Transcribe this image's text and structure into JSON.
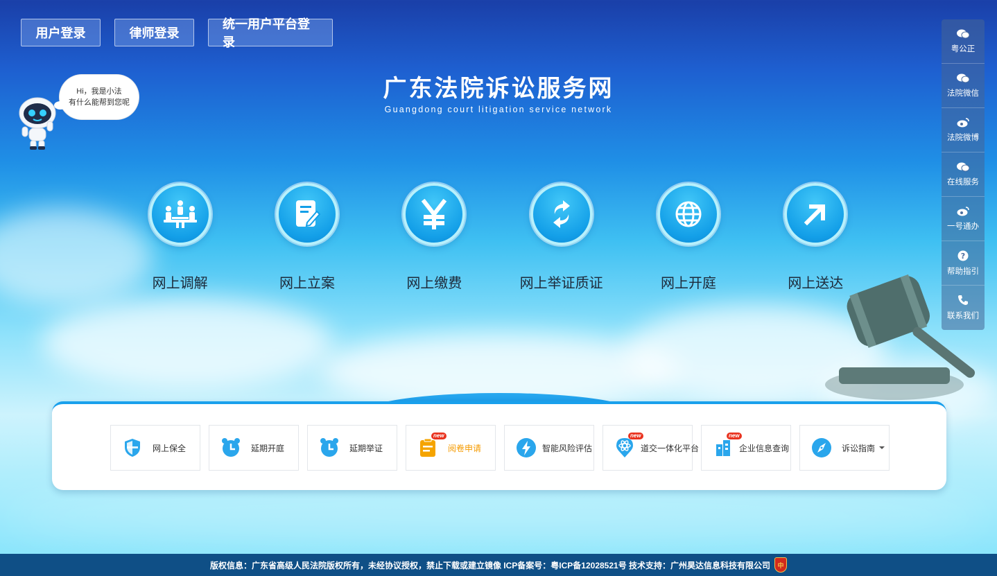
{
  "login": {
    "user": "用户登录",
    "lawyer": "律师登录",
    "unified": "统一用户平台登录"
  },
  "site": {
    "title_cn": "广东法院诉讼服务网",
    "title_en": "Guangdong court litigation service network"
  },
  "assistant": {
    "line1": "Hi，我是小法",
    "line2": "有什么能帮到您呢"
  },
  "services": [
    {
      "label": "网上调解",
      "icon": "mediation-icon"
    },
    {
      "label": "网上立案",
      "icon": "filing-icon"
    },
    {
      "label": "网上缴费",
      "icon": "yuan-icon"
    },
    {
      "label": "网上举证质证",
      "icon": "evidence-icon"
    },
    {
      "label": "网上开庭",
      "icon": "globe-icon"
    },
    {
      "label": "网上送达",
      "icon": "arrow-icon"
    }
  ],
  "sidebar": [
    {
      "label": "粤公正",
      "icon": "wechat-icon"
    },
    {
      "label": "法院微信",
      "icon": "wechat-icon"
    },
    {
      "label": "法院微博",
      "icon": "weibo-icon"
    },
    {
      "label": "在线服务",
      "icon": "wechat-icon"
    },
    {
      "label": "一号通办",
      "icon": "weibo-icon"
    },
    {
      "label": "帮助指引",
      "icon": "help-icon"
    },
    {
      "label": "联系我们",
      "icon": "phone-icon"
    }
  ],
  "quick": [
    {
      "label": "网上保全",
      "icon": "shield-icon"
    },
    {
      "label": "延期开庭",
      "icon": "alarm-clock-icon"
    },
    {
      "label": "延期举证",
      "icon": "alarm-clock-icon"
    },
    {
      "label": "阅卷申请",
      "icon": "document-icon",
      "badge": "new"
    },
    {
      "label": "智能风险评估",
      "icon": "lightning-icon"
    },
    {
      "label": "道交一体化平台",
      "icon": "atom-icon",
      "badge": "new"
    },
    {
      "label": "企业信息查询",
      "icon": "building-icon",
      "badge": "new"
    },
    {
      "label": "诉讼指南",
      "icon": "compass-icon"
    }
  ],
  "footer": {
    "text": "版权信息：广东省高级人民法院版权所有，未经协议授权，禁止下载或建立镜像 ICP备案号：粤ICP备12028521号 技术支持：广州昊达信息科技有限公司",
    "badge": "中"
  },
  "colors": {
    "primary": "#139fe8",
    "highlight": "#f59b00",
    "new_badge": "#e9321e",
    "footer": "#0f4f86"
  }
}
